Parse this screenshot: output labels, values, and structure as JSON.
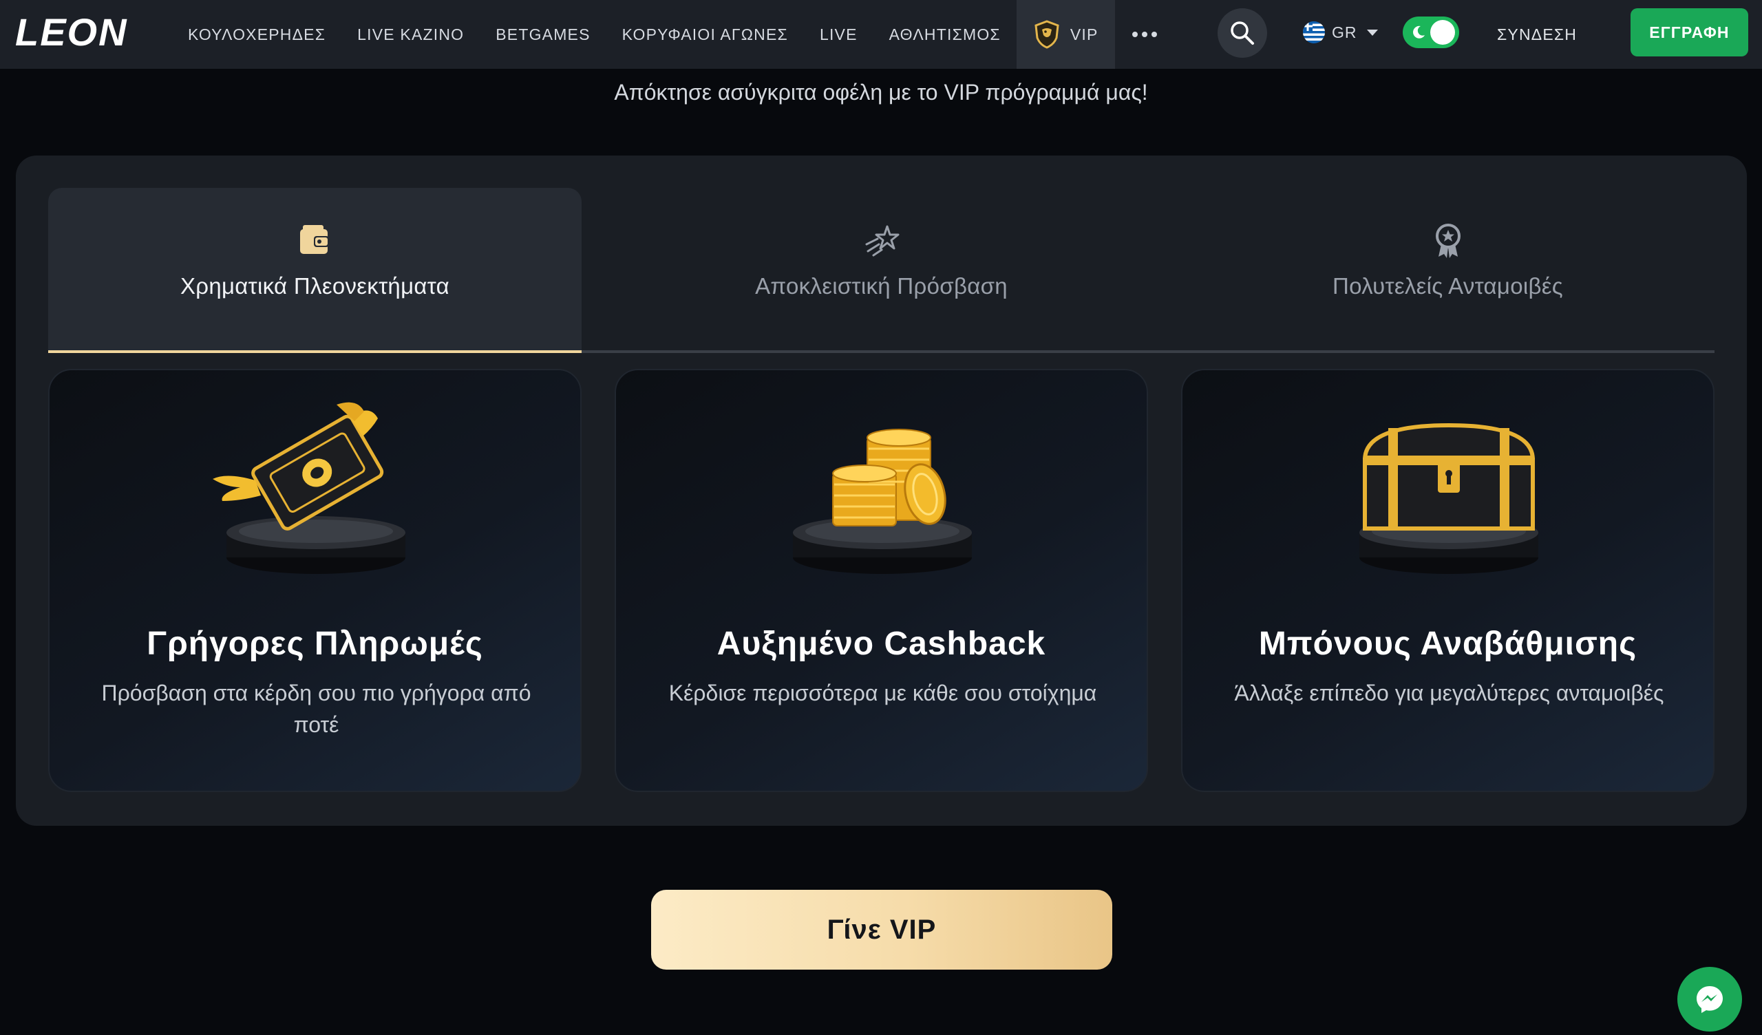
{
  "brand": {
    "logo_text": "LEON"
  },
  "nav": {
    "items": [
      "ΚΟΥΛΟΧΕΡΗΔΕΣ",
      "LIVE ΚΑΖΙΝΟ",
      "BETGAMES",
      "ΚΟΡΥΦΑΙΟΙ ΑΓΩΝΕΣ",
      "LIVE",
      "ΑΘΛΗΤΙΣΜΟΣ"
    ],
    "vip_label": "VIP",
    "more_icon": "more-dots-icon"
  },
  "header": {
    "search_icon": "search-icon",
    "language": {
      "code": "GR",
      "flag": "greece-flag-icon"
    },
    "theme_toggle": {
      "state": "dark",
      "icon": "moon-icon"
    },
    "login_label": "ΣΥΝΔΕΣΗ",
    "register_label": "ΕΓΓΡΑΦΗ"
  },
  "subtitle": "Απόκτησε ασύγκριτα οφέλη με το VIP πρόγραμμά μας!",
  "tabs": [
    {
      "label": "Χρηματικά Πλεονεκτήματα",
      "icon": "wallet-icon",
      "active": true
    },
    {
      "label": "Αποκλειστική Πρόσβαση",
      "icon": "shooting-star-icon",
      "active": false
    },
    {
      "label": "Πολυτελείς Ανταμοιβές",
      "icon": "award-badge-icon",
      "active": false
    }
  ],
  "cards": [
    {
      "title": "Γρήγορες Πληρωμές",
      "text": "Πρόσβαση στα κέρδη σου πιο γρήγορα από ποτέ",
      "illustration": "winged-banknote-on-podium"
    },
    {
      "title": "Αυξημένο Cashback",
      "text": "Κέρδισε περισσότερα με κάθε σου στοίχημα",
      "illustration": "gold-coin-stack-on-podium"
    },
    {
      "title": "Μπόνους Αναβάθμισης",
      "text": "Άλλαξε επίπεδο για μεγαλύτερες ανταμοιβές",
      "illustration": "treasure-chest-on-podium"
    }
  ],
  "cta_label": "Γίνε VIP",
  "chat_icon": "messenger-chat-icon",
  "colors": {
    "accent_gold": "#f0d59c",
    "brand_green": "#1aa857",
    "nav_bg": "#1c2027",
    "page_bg": "#07090d"
  }
}
